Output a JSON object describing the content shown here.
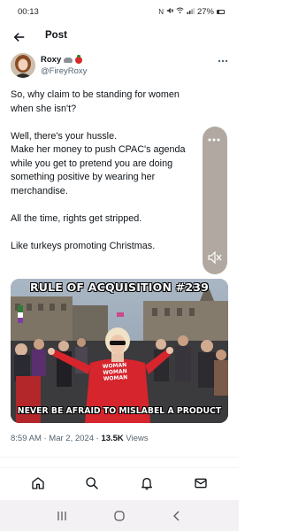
{
  "status_bar": {
    "time": "00:13",
    "battery": "27%"
  },
  "header": {
    "title": "Post"
  },
  "author": {
    "name": "Roxy",
    "handle": "@FireyRoxy"
  },
  "tweet": {
    "lines": [
      "So, why claim to be standing for women",
      "when she isn't?",
      "",
      "Well, there's your hussle.",
      "Make her money to push CPAC's agenda",
      "while you get to pretend you are doing",
      "something positive by wearing her",
      "merchandise.",
      "",
      "All the time, rights get stripped.",
      "",
      "Like turkeys promoting Christmas."
    ]
  },
  "media": {
    "top_caption": "RULE OF ACQUISITION #239",
    "bottom_caption": "NEVER BE AFRAID TO MISLABEL A PRODUCT",
    "shirt_text": [
      "WOMAN",
      "WOMAN",
      "WOMAN"
    ]
  },
  "meta": {
    "timestamp": "8:59 AM · Mar 2, 2024 · ",
    "views_count": "13.5K",
    "views_label": " Views"
  },
  "bottom_nav": {
    "items": [
      "home",
      "search",
      "notifications",
      "messages"
    ]
  },
  "colors": {
    "text": "#0f1419",
    "secondary": "#536471",
    "divider": "#eff3f4",
    "system_nav_bg": "#f4f1f4"
  }
}
